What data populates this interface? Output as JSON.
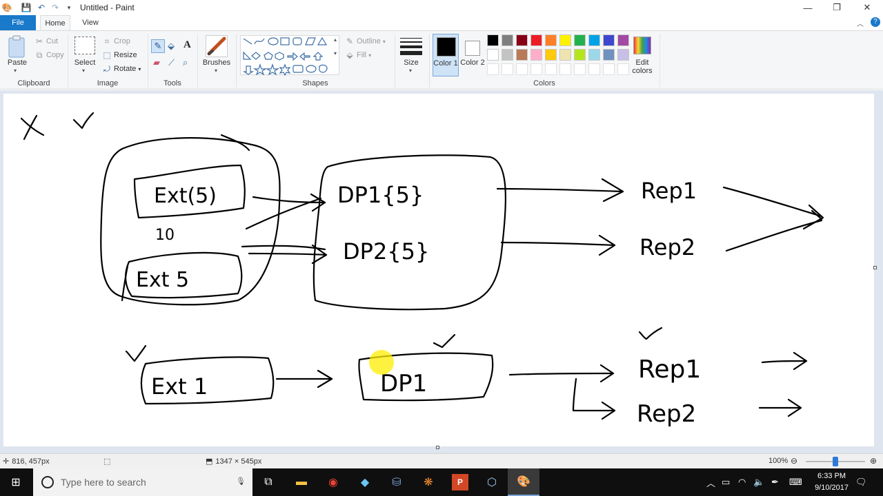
{
  "window": {
    "title": "Untitled - Paint",
    "minimize_icon": "minimize-icon",
    "restore_icon": "restore-icon",
    "close_icon": "close-icon"
  },
  "tabs": {
    "file": "File",
    "home": "Home",
    "view": "View"
  },
  "ribbon": {
    "clipboard": {
      "group_label": "Clipboard",
      "paste": "Paste",
      "cut": "Cut",
      "copy": "Copy"
    },
    "image": {
      "group_label": "Image",
      "select": "Select",
      "crop": "Crop",
      "resize": "Resize",
      "rotate": "Rotate"
    },
    "tools": {
      "group_label": "Tools"
    },
    "brushes": {
      "label": "Brushes"
    },
    "shapes": {
      "group_label": "Shapes",
      "outline": "Outline",
      "fill": "Fill"
    },
    "size": {
      "label": "Size"
    },
    "colors": {
      "group_label": "Colors",
      "color1_label": "Color 1",
      "color2_label": "Color 2",
      "edit_colors": "Edit colors",
      "color1": "#000000",
      "color2": "#ffffff",
      "row1": [
        "#000000",
        "#7f7f7f",
        "#880015",
        "#ed1c24",
        "#ff7f27",
        "#fff200",
        "#22b14c",
        "#00a2e8",
        "#3f48cc",
        "#a349a4"
      ],
      "row2": [
        "#ffffff",
        "#c3c3c3",
        "#b97a57",
        "#ffaec9",
        "#ffc90e",
        "#efe4b0",
        "#b5e61d",
        "#99d9ea",
        "#7092be",
        "#c8bfe7"
      ]
    }
  },
  "status": {
    "cursor_position": "816, 457px",
    "canvas_size": "1347 × 545px",
    "zoom": "100%"
  },
  "taskbar": {
    "search_placeholder": "Type here to search",
    "time": "6:33 PM",
    "date": "9/10/2017"
  },
  "drawing": {
    "texts": {
      "ext_upper": "Ext(5)",
      "ten": "10",
      "ext_lower": "Ext 5",
      "dp1_upper": "DP1{5}",
      "dp2_upper": "DP2{5}",
      "rep1_upper": "Rep1",
      "rep2_upper": "Rep2",
      "ext_bottom": "Ext 1",
      "dp1_bottom": "DP1",
      "rep1_bottom": "Rep1",
      "rep2_bottom": "Rep2"
    }
  }
}
